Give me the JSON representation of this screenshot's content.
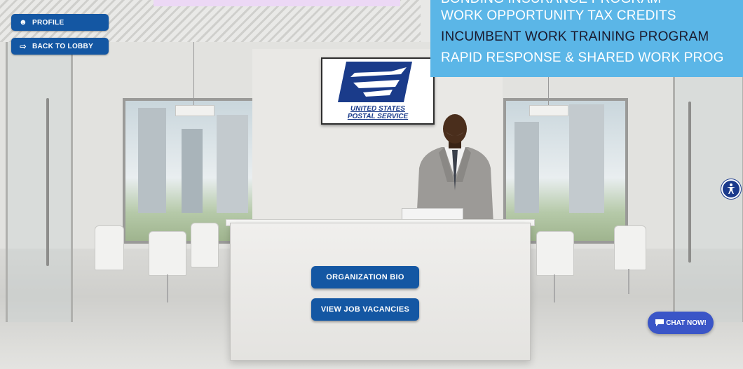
{
  "nav": {
    "profile_label": "PROFILE",
    "back_label": "BACK TO LOBBY"
  },
  "banner": {
    "lines": [
      "BONDING INSURANCE PROGRAM",
      "WORK OPPORTUNITY TAX CREDITS",
      "INCUMBENT WORK TRAINING PROGRAM",
      "RAPID RESPONSE & SHARED WORK PROG"
    ],
    "line_colors": [
      "#ffffff",
      "#ffffff",
      "#1a1a2e",
      "#ffffff"
    ],
    "background": "#5bb6e7"
  },
  "sign": {
    "line1": "UNITED STATES",
    "line2": "POSTAL SERVICE",
    "brand_color": "#1a3b8a"
  },
  "desk": {
    "bio_label": "ORGANIZATION BIO",
    "vacancies_label": "VIEW JOB VACANCIES"
  },
  "chat": {
    "label": "CHAT NOW!"
  },
  "icons": {
    "profile": "user-icon",
    "back": "exit-icon",
    "chat": "chat-bubble-icon",
    "accessibility": "accessibility-icon"
  },
  "colors": {
    "button_blue": "#1457a3",
    "chat_blue": "#3a55c7",
    "accessibility_blue": "#1b3a8c"
  }
}
